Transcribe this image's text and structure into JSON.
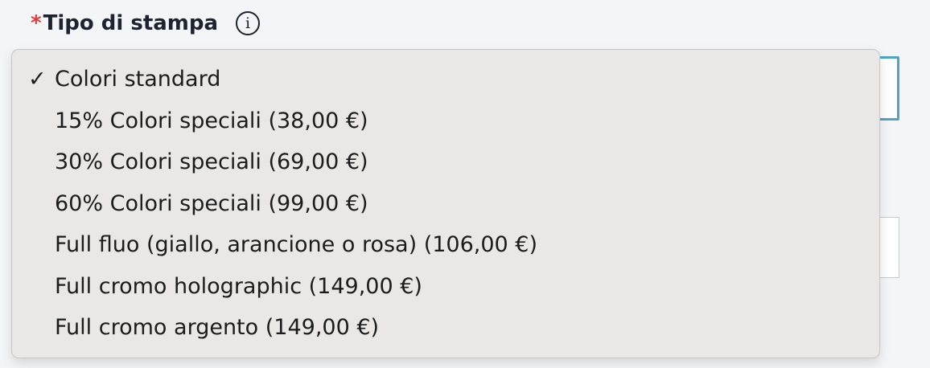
{
  "field": {
    "required_mark": "*",
    "label": "Tipo di stampa",
    "info_icon": "info-icon"
  },
  "dropdown": {
    "check_mark": "✓",
    "options": [
      {
        "label": "Colori standard",
        "selected": true
      },
      {
        "label": "15% Colori speciali (38,00 €)",
        "selected": false
      },
      {
        "label": "30% Colori speciali (69,00 €)",
        "selected": false
      },
      {
        "label": "60% Colori speciali (99,00 €)",
        "selected": false
      },
      {
        "label": "Full fluo (giallo, arancione o rosa) (106,00 €)",
        "selected": false
      },
      {
        "label": "Full cromo holographic (149,00 €)",
        "selected": false
      },
      {
        "label": "Full cromo argento (149,00 €)",
        "selected": false
      }
    ]
  },
  "colors": {
    "focus_border": "#4fa3c5",
    "required": "#e03a3a",
    "dropdown_bg": "#e9e8e6"
  }
}
